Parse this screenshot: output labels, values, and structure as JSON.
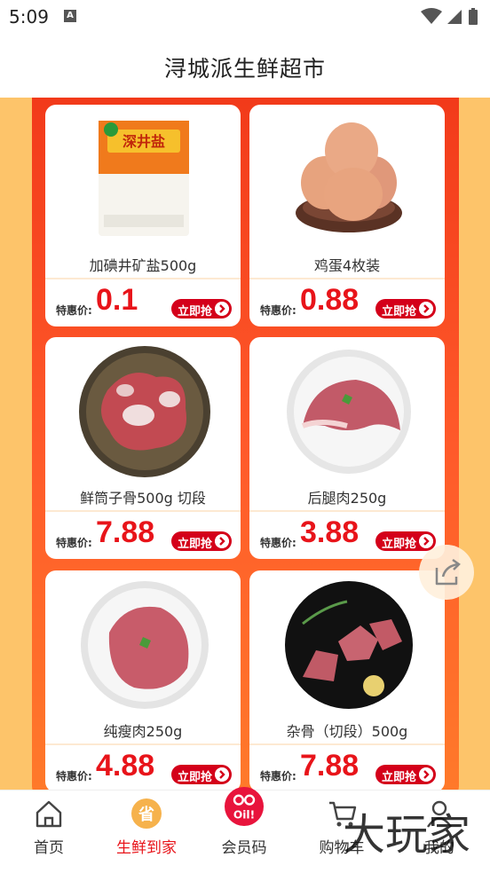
{
  "status_bar": {
    "time": "5:09",
    "badge": "A"
  },
  "header": {
    "title": "浔城派生鲜超市"
  },
  "products": [
    {
      "name": "加碘井矿盐500g",
      "price_label": "特惠价:",
      "price": "0.1",
      "buy_label": "立即抢"
    },
    {
      "name": "鸡蛋4枚装",
      "price_label": "特惠价:",
      "price": "0.88",
      "buy_label": "立即抢"
    },
    {
      "name": "鲜筒子骨500g 切段",
      "price_label": "特惠价:",
      "price": "7.88",
      "buy_label": "立即抢"
    },
    {
      "name": "后腿肉250g",
      "price_label": "特惠价:",
      "price": "3.88",
      "buy_label": "立即抢"
    },
    {
      "name": "纯瘦肉250g",
      "price_label": "特惠价:",
      "price": "4.88",
      "buy_label": "立即抢"
    },
    {
      "name": "杂骨（切段）500g",
      "price_label": "特惠价:",
      "price": "7.88",
      "buy_label": "立即抢"
    }
  ],
  "salt_pack_text": "深井盐",
  "tabs": [
    {
      "label": "首页",
      "icon": "home-icon",
      "active": false
    },
    {
      "label": "生鲜到家",
      "icon": "save-coin-icon",
      "active": true
    },
    {
      "label": "会员码",
      "icon": "member-code-icon",
      "active": false
    },
    {
      "label": "购物车",
      "icon": "cart-icon",
      "active": false
    },
    {
      "label": "我的",
      "icon": "profile-icon",
      "active": false
    }
  ],
  "member_icon_text": "OO\nOil!",
  "coin_icon_text": "省",
  "watermark": "大玩家",
  "colors": {
    "accent": "#e8141a",
    "panel": "#f23a1a",
    "background": "#fdc46a"
  }
}
